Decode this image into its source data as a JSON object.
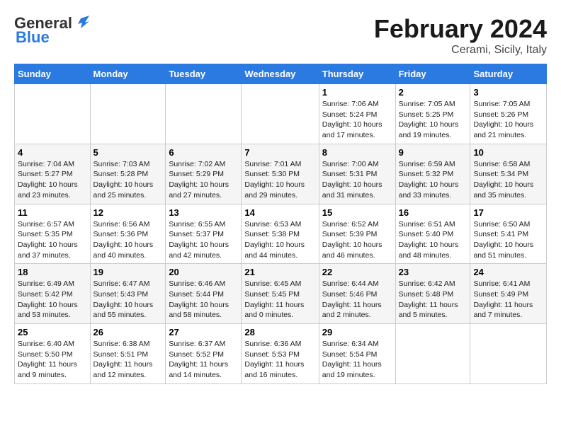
{
  "header": {
    "logo_general": "General",
    "logo_blue": "Blue",
    "month_title": "February 2024",
    "location": "Cerami, Sicily, Italy"
  },
  "weekdays": [
    "Sunday",
    "Monday",
    "Tuesday",
    "Wednesday",
    "Thursday",
    "Friday",
    "Saturday"
  ],
  "weeks": [
    [
      {
        "day": "",
        "info": ""
      },
      {
        "day": "",
        "info": ""
      },
      {
        "day": "",
        "info": ""
      },
      {
        "day": "",
        "info": ""
      },
      {
        "day": "1",
        "info": "Sunrise: 7:06 AM\nSunset: 5:24 PM\nDaylight: 10 hours\nand 17 minutes."
      },
      {
        "day": "2",
        "info": "Sunrise: 7:05 AM\nSunset: 5:25 PM\nDaylight: 10 hours\nand 19 minutes."
      },
      {
        "day": "3",
        "info": "Sunrise: 7:05 AM\nSunset: 5:26 PM\nDaylight: 10 hours\nand 21 minutes."
      }
    ],
    [
      {
        "day": "4",
        "info": "Sunrise: 7:04 AM\nSunset: 5:27 PM\nDaylight: 10 hours\nand 23 minutes."
      },
      {
        "day": "5",
        "info": "Sunrise: 7:03 AM\nSunset: 5:28 PM\nDaylight: 10 hours\nand 25 minutes."
      },
      {
        "day": "6",
        "info": "Sunrise: 7:02 AM\nSunset: 5:29 PM\nDaylight: 10 hours\nand 27 minutes."
      },
      {
        "day": "7",
        "info": "Sunrise: 7:01 AM\nSunset: 5:30 PM\nDaylight: 10 hours\nand 29 minutes."
      },
      {
        "day": "8",
        "info": "Sunrise: 7:00 AM\nSunset: 5:31 PM\nDaylight: 10 hours\nand 31 minutes."
      },
      {
        "day": "9",
        "info": "Sunrise: 6:59 AM\nSunset: 5:32 PM\nDaylight: 10 hours\nand 33 minutes."
      },
      {
        "day": "10",
        "info": "Sunrise: 6:58 AM\nSunset: 5:34 PM\nDaylight: 10 hours\nand 35 minutes."
      }
    ],
    [
      {
        "day": "11",
        "info": "Sunrise: 6:57 AM\nSunset: 5:35 PM\nDaylight: 10 hours\nand 37 minutes."
      },
      {
        "day": "12",
        "info": "Sunrise: 6:56 AM\nSunset: 5:36 PM\nDaylight: 10 hours\nand 40 minutes."
      },
      {
        "day": "13",
        "info": "Sunrise: 6:55 AM\nSunset: 5:37 PM\nDaylight: 10 hours\nand 42 minutes."
      },
      {
        "day": "14",
        "info": "Sunrise: 6:53 AM\nSunset: 5:38 PM\nDaylight: 10 hours\nand 44 minutes."
      },
      {
        "day": "15",
        "info": "Sunrise: 6:52 AM\nSunset: 5:39 PM\nDaylight: 10 hours\nand 46 minutes."
      },
      {
        "day": "16",
        "info": "Sunrise: 6:51 AM\nSunset: 5:40 PM\nDaylight: 10 hours\nand 48 minutes."
      },
      {
        "day": "17",
        "info": "Sunrise: 6:50 AM\nSunset: 5:41 PM\nDaylight: 10 hours\nand 51 minutes."
      }
    ],
    [
      {
        "day": "18",
        "info": "Sunrise: 6:49 AM\nSunset: 5:42 PM\nDaylight: 10 hours\nand 53 minutes."
      },
      {
        "day": "19",
        "info": "Sunrise: 6:47 AM\nSunset: 5:43 PM\nDaylight: 10 hours\nand 55 minutes."
      },
      {
        "day": "20",
        "info": "Sunrise: 6:46 AM\nSunset: 5:44 PM\nDaylight: 10 hours\nand 58 minutes."
      },
      {
        "day": "21",
        "info": "Sunrise: 6:45 AM\nSunset: 5:45 PM\nDaylight: 11 hours\nand 0 minutes."
      },
      {
        "day": "22",
        "info": "Sunrise: 6:44 AM\nSunset: 5:46 PM\nDaylight: 11 hours\nand 2 minutes."
      },
      {
        "day": "23",
        "info": "Sunrise: 6:42 AM\nSunset: 5:48 PM\nDaylight: 11 hours\nand 5 minutes."
      },
      {
        "day": "24",
        "info": "Sunrise: 6:41 AM\nSunset: 5:49 PM\nDaylight: 11 hours\nand 7 minutes."
      }
    ],
    [
      {
        "day": "25",
        "info": "Sunrise: 6:40 AM\nSunset: 5:50 PM\nDaylight: 11 hours\nand 9 minutes."
      },
      {
        "day": "26",
        "info": "Sunrise: 6:38 AM\nSunset: 5:51 PM\nDaylight: 11 hours\nand 12 minutes."
      },
      {
        "day": "27",
        "info": "Sunrise: 6:37 AM\nSunset: 5:52 PM\nDaylight: 11 hours\nand 14 minutes."
      },
      {
        "day": "28",
        "info": "Sunrise: 6:36 AM\nSunset: 5:53 PM\nDaylight: 11 hours\nand 16 minutes."
      },
      {
        "day": "29",
        "info": "Sunrise: 6:34 AM\nSunset: 5:54 PM\nDaylight: 11 hours\nand 19 minutes."
      },
      {
        "day": "",
        "info": ""
      },
      {
        "day": "",
        "info": ""
      }
    ]
  ]
}
